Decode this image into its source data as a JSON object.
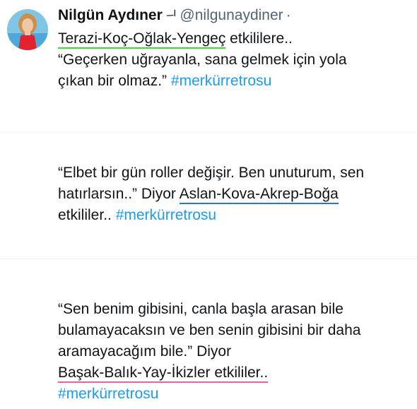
{
  "author": {
    "name": "Nilgün Aydıner",
    "badge": "ᅴ",
    "handle": "@nilgunaydiner",
    "separator": "·"
  },
  "colors": {
    "hashtag": "#1d9bf0",
    "underline_green": "#3ddc2f",
    "underline_blue": "#2f6fe0",
    "underline_pink": "#e85fa8"
  },
  "tweet1": {
    "signs": "Terazi-Koç-Oğlak-Yengeç",
    "signs_suffix": " etkililere..",
    "quote_line1": "“Geçerken uğrayanla, sana gelmek için yola",
    "quote_line2": "çıkan bir olmaz.” ",
    "hashtag": "#merkürretrosu"
  },
  "tweet2": {
    "line1": "“Elbet bir gün roller değişir. Ben unuturum, sen",
    "line2_prefix": "hatırlarsın..” Diyor ",
    "signs": "Aslan-Kova-Akrep-Boğa",
    "line3_prefix": "etkililer.. ",
    "hashtag": "#merkürretrosu"
  },
  "tweet3": {
    "line1": "“Sen benim gibisini, canla başla arasan bile",
    "line2": "bulamayacaksın ve ben senin gibisini bir daha",
    "line3": "aramayacağım bile.” Diyor",
    "signs": "Başak-Balık-Yay-İkizler etkililer..",
    "hashtag": "#merkürretrosu"
  }
}
